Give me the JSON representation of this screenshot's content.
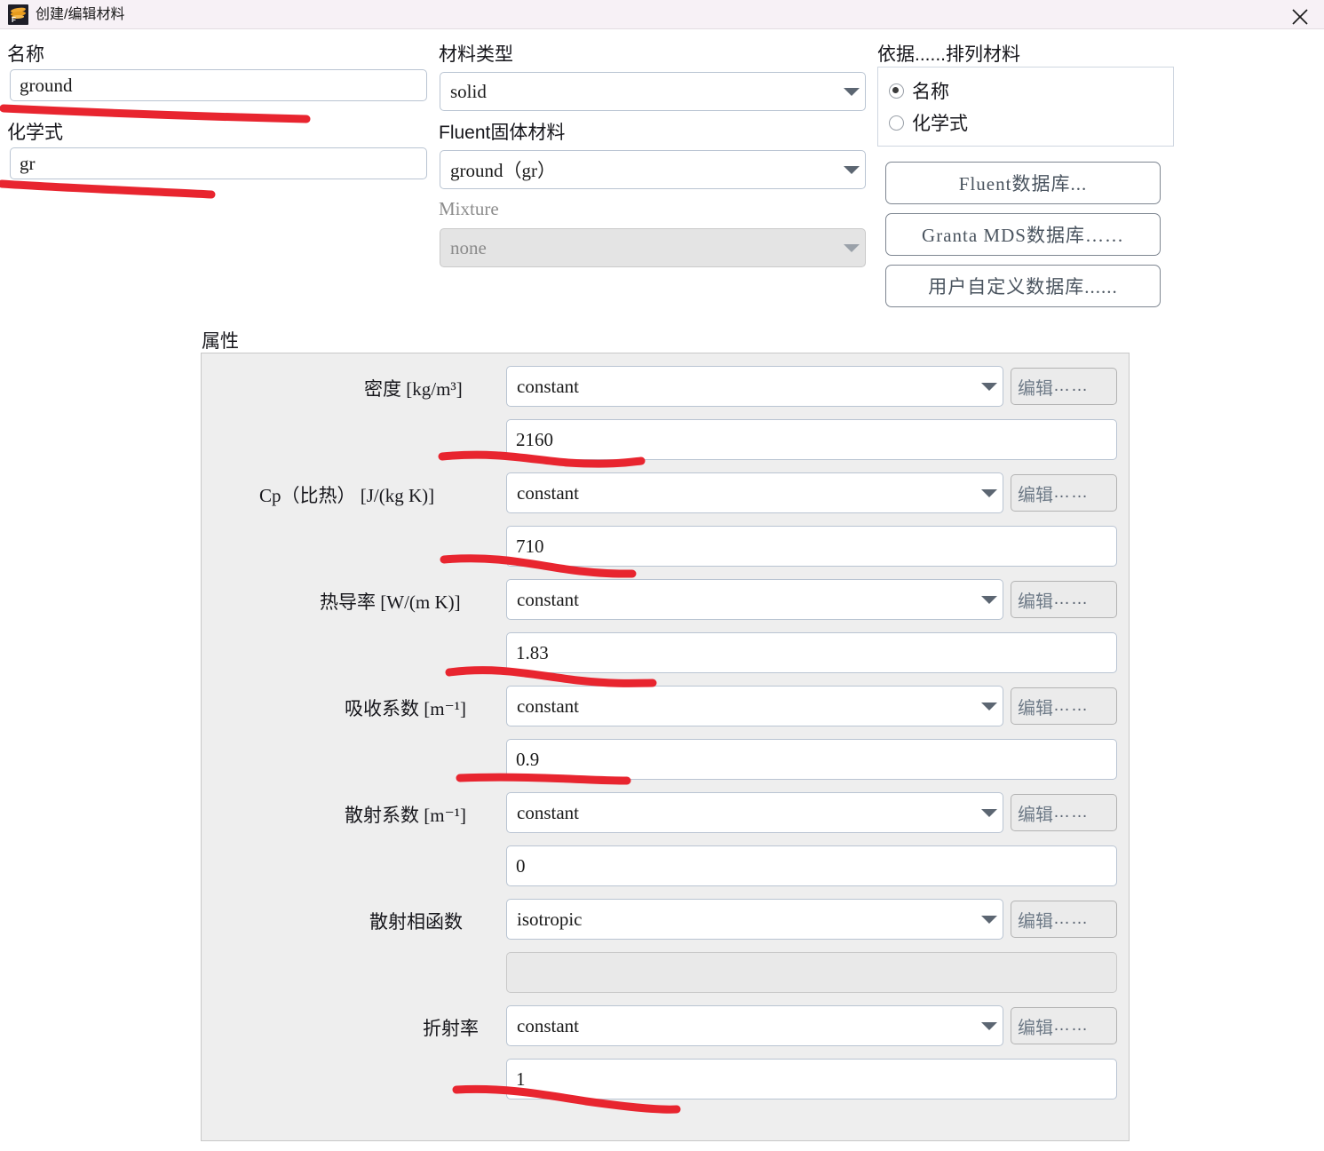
{
  "window": {
    "title": "创建/编辑材料",
    "icon": "fluent-logo-icon",
    "close_label": "×"
  },
  "left_column": {
    "name_label": "名称",
    "name_value": "ground",
    "formula_label": "化学式",
    "formula_value": "gr"
  },
  "middle_column": {
    "material_type_label": "材料类型",
    "material_type_value": "solid",
    "fluent_solid_label": "Fluent固体材料",
    "fluent_solid_value": "ground（gr）",
    "mixture_label": "Mixture",
    "mixture_value": "none"
  },
  "right_column": {
    "order_label": "依据......排列材料",
    "order_options": [
      {
        "label": "名称",
        "selected": true
      },
      {
        "label": "化学式",
        "selected": false
      }
    ],
    "buttons": [
      "Fluent数据库...",
      "Granta MDS数据库……",
      "用户自定义数据库......"
    ]
  },
  "properties": {
    "title": "属性",
    "edit_label": "编辑",
    "edit_dots": "……",
    "rows": [
      {
        "label": "密度  [kg/m³]",
        "method": "constant",
        "value": "2160",
        "value_disabled": false,
        "has_edit": true
      },
      {
        "label": "Cp（比热）  [J/(kg K)]",
        "method": "constant",
        "value": "710",
        "value_disabled": false,
        "has_edit": true
      },
      {
        "label": "热导率  [W/(m K)]",
        "method": "constant",
        "value": "1.83",
        "value_disabled": false,
        "has_edit": true
      },
      {
        "label": "吸收系数  [m⁻¹]",
        "method": "constant",
        "value": "0.9",
        "value_disabled": false,
        "has_edit": true
      },
      {
        "label": "散射系数  [m⁻¹]",
        "method": "constant",
        "value": "0",
        "value_disabled": false,
        "has_edit": true
      },
      {
        "label": "散射相函数",
        "method": "isotropic",
        "value": "",
        "value_disabled": true,
        "has_edit": true
      },
      {
        "label": "折射率",
        "method": "constant",
        "value": "1",
        "value_disabled": false,
        "has_edit": true
      }
    ]
  },
  "annotations": {
    "color": "#e8252f",
    "count": 7
  }
}
